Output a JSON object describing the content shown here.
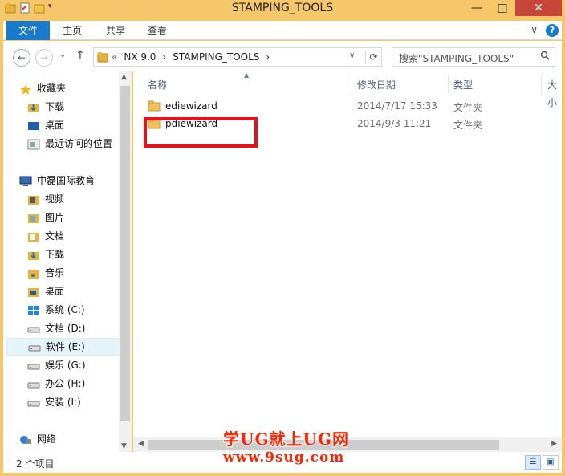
{
  "window": {
    "title": "STAMPING_TOOLS",
    "min": "—",
    "max": "□",
    "close": "✕"
  },
  "ribbon": {
    "tabs": [
      {
        "label": "文件"
      },
      {
        "label": "主页"
      },
      {
        "label": "共享"
      },
      {
        "label": "查看"
      }
    ],
    "collapse": "∨",
    "help": "?"
  },
  "address": {
    "overflow": "«",
    "crumbs": [
      "NX 9.0",
      "›",
      "STAMPING_TOOLS",
      "›"
    ],
    "dropdown": "∨",
    "refresh": "⟳"
  },
  "search": {
    "placeholder": "搜索\"STAMPING_TOOLS\""
  },
  "nav": {
    "back": "←",
    "forward": "→",
    "recent": "⌄",
    "up": "↑"
  },
  "navpane": {
    "favorites": {
      "label": "收藏夹",
      "items": [
        "下载",
        "桌面",
        "最近访问的位置"
      ]
    },
    "computer": {
      "label": "中磊国际教育",
      "items": [
        "视频",
        "图片",
        "文档",
        "下载",
        "音乐",
        "桌面",
        "系统 (C:)",
        "文档 (D:)",
        "软件 (E:)",
        "娱乐 (G:)",
        "办公 (H:)",
        "安装 (I:)"
      ]
    },
    "network": {
      "label": "网络"
    }
  },
  "columns": {
    "name": "名称",
    "date": "修改日期",
    "type": "类型",
    "size": "大小"
  },
  "files": [
    {
      "name": "ediewizard",
      "date": "2014/7/17 15:33",
      "type": "文件夹"
    },
    {
      "name": "pdiewizard",
      "date": "2014/9/3 11:21",
      "type": "文件夹"
    }
  ],
  "status": {
    "count": "2 个项目"
  },
  "watermark": {
    "line1": "学UG就上UG网",
    "line2": "www.9sug.com"
  },
  "colors": {
    "accent": "#1979ca",
    "highlight": "#e8111a",
    "titlebar": "#f5c66a",
    "watermark": "#ff2400"
  }
}
